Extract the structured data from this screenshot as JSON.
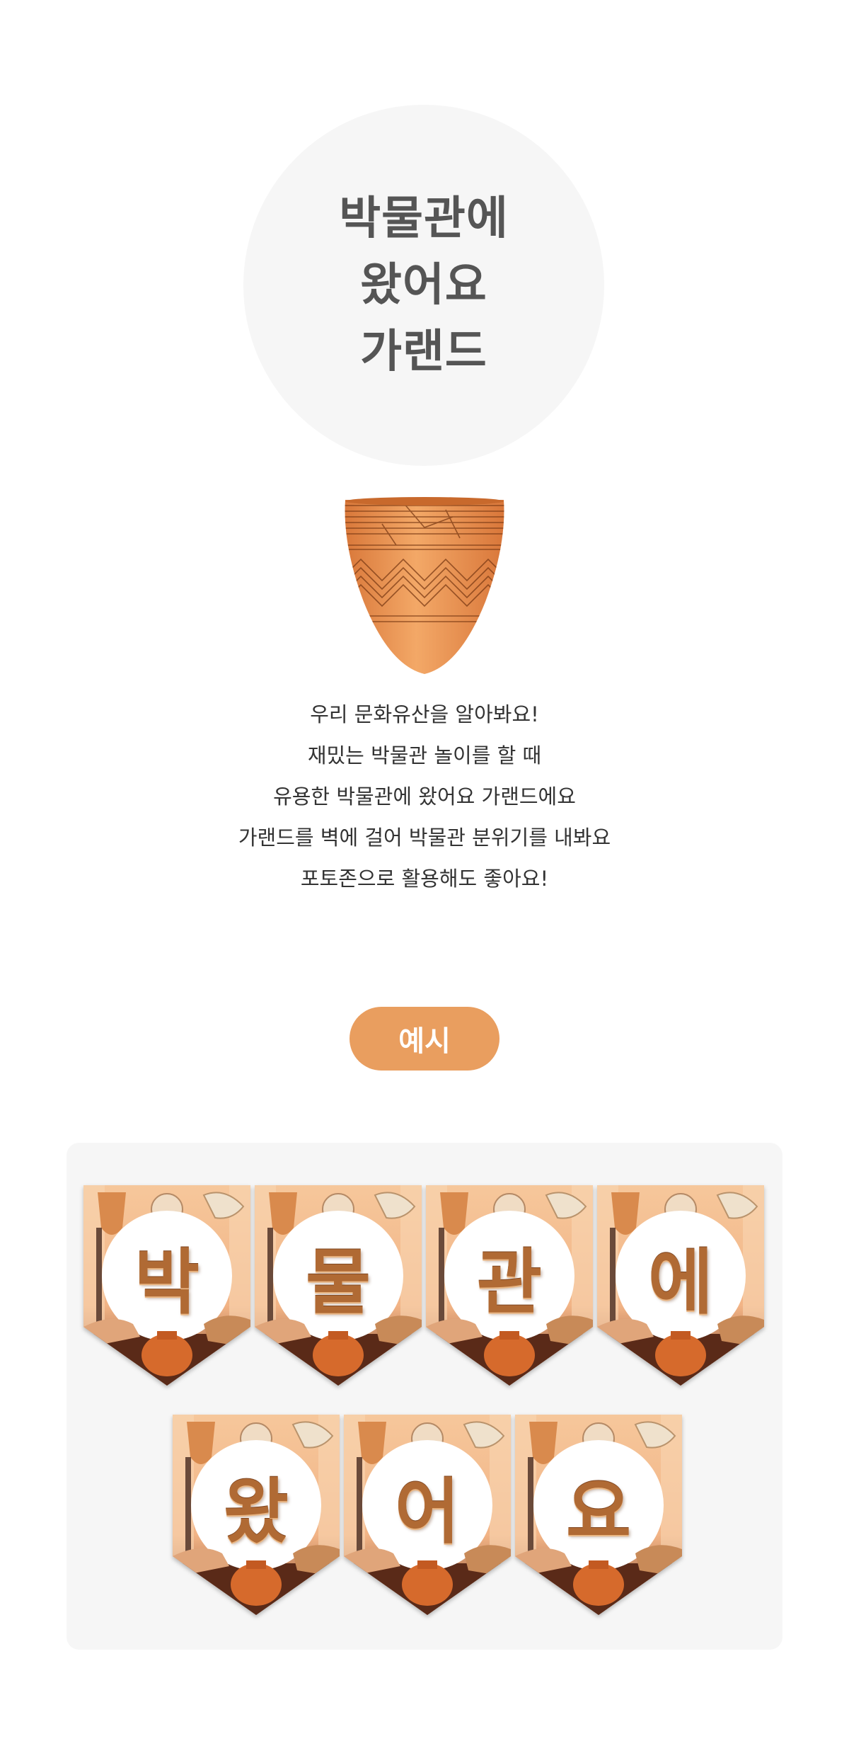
{
  "title": {
    "lines": [
      "박물관에",
      "왔어요",
      "가랜드"
    ]
  },
  "illustration": {
    "icon": "comb-pattern-pottery-icon"
  },
  "description": {
    "lines": [
      "우리 문화유산을 알아봐요!",
      "재밌는 박물관 놀이를 할 때",
      "유용한 박물관에 왔어요 가랜드에요",
      "가랜드를 벽에 걸어 박물관 분위기를 내봐요",
      "포토존으로 활용해도 좋아요!"
    ]
  },
  "example": {
    "label": "예시",
    "flags": [
      "박",
      "물",
      "관",
      "에",
      "왔",
      "어",
      "요"
    ]
  },
  "colors": {
    "accent": "#e99e5f",
    "title_text": "#555555",
    "circle_bg": "#f6f6f6",
    "flag_letter": "#b06a34"
  }
}
